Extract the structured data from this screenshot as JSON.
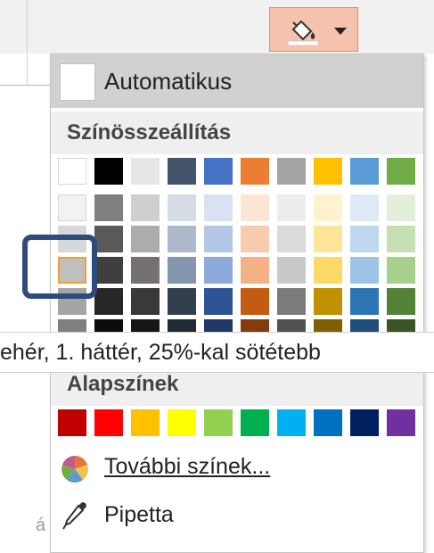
{
  "menu": {
    "automatic_label": "Automatikus",
    "theme_section": "Színösszeállítás",
    "standard_section": "Alapszínek",
    "more_colors_label": "További színek...",
    "eyedropper_label": "Pipetta"
  },
  "tooltip": {
    "text": "ehér, 1. háttér, 25%-kal sötétebb"
  },
  "selected_color": "#bfbfbf",
  "theme_colors": [
    [
      "#ffffff",
      "#000000",
      "#e7e6e6",
      "#44546a",
      "#4472c4",
      "#ed7d31",
      "#a5a5a5",
      "#ffc000",
      "#5b9bd5",
      "#70ad47"
    ],
    [
      "#f2f2f2",
      "#7f7f7f",
      "#d0cece",
      "#d6dce4",
      "#d9e2f3",
      "#fbe5d5",
      "#ededed",
      "#fff2cc",
      "#deebf6",
      "#e2efd9"
    ],
    [
      "#d8d8d8",
      "#595959",
      "#aeabab",
      "#adb9ca",
      "#b4c6e7",
      "#f7cbac",
      "#dbdbdb",
      "#fee599",
      "#bdd7ee",
      "#c5e0b3"
    ],
    [
      "#bfbfbf",
      "#3f3f3f",
      "#767171",
      "#8496b0",
      "#8eaadb",
      "#f4b183",
      "#c9c9c9",
      "#ffd965",
      "#9dc3e6",
      "#a8d08d"
    ],
    [
      "#a5a5a5",
      "#262626",
      "#3a3838",
      "#323f4f",
      "#2f5496",
      "#c55a11",
      "#7b7b7b",
      "#bf9000",
      "#2e75b5",
      "#538135"
    ],
    [
      "#7f7f7f",
      "#0c0c0c",
      "#171616",
      "#222a35",
      "#1f3864",
      "#833c0b",
      "#525252",
      "#7f6000",
      "#1e4e79",
      "#375623"
    ]
  ],
  "standard_colors": [
    "#c00000",
    "#ff0000",
    "#ffc000",
    "#ffff00",
    "#92d050",
    "#00b050",
    "#00b0f0",
    "#0070c0",
    "#002060",
    "#7030a0"
  ],
  "colors": {
    "button_fill": "#f4c2ad",
    "selection_border": "#f0a030",
    "highlight_frame": "#2f4a7c",
    "panel_hover": "#d1d1d1"
  },
  "icons": {
    "fill": "paint-bucket-icon",
    "dropdown": "triangle-down-icon",
    "more_colors": "color-wheel-icon",
    "eyedropper": "eyedropper-icon"
  }
}
